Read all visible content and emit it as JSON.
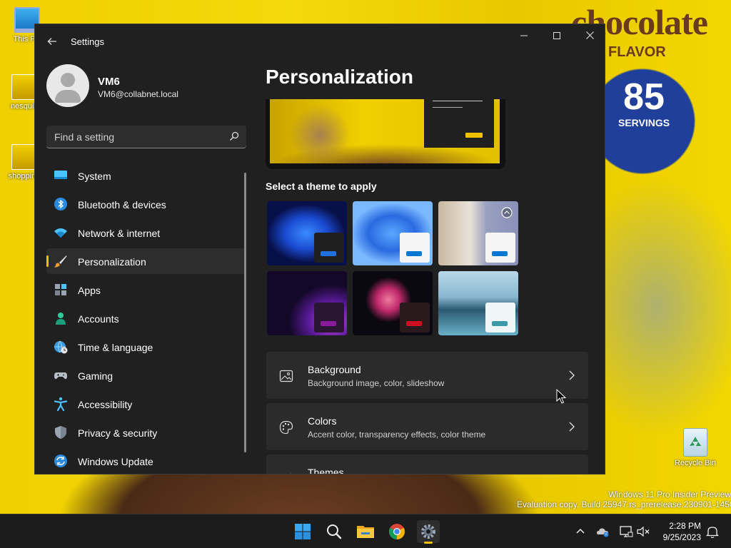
{
  "window": {
    "title": "Settings",
    "back_icon": "back-arrow-icon",
    "minimize": "─",
    "maximize": "☐",
    "close": "✕"
  },
  "user": {
    "name": "VM6",
    "email": "VM6@collabnet.local"
  },
  "search": {
    "placeholder": "Find a setting",
    "value": ""
  },
  "nav": {
    "items": [
      {
        "label": "System",
        "icon": "monitor-icon"
      },
      {
        "label": "Bluetooth & devices",
        "icon": "bluetooth-icon"
      },
      {
        "label": "Network & internet",
        "icon": "wifi-icon"
      },
      {
        "label": "Personalization",
        "icon": "paintbrush-icon",
        "active": true
      },
      {
        "label": "Apps",
        "icon": "apps-icon"
      },
      {
        "label": "Accounts",
        "icon": "person-icon"
      },
      {
        "label": "Time & language",
        "icon": "globe-clock-icon"
      },
      {
        "label": "Gaming",
        "icon": "gamepad-icon"
      },
      {
        "label": "Accessibility",
        "icon": "accessibility-icon"
      },
      {
        "label": "Privacy & security",
        "icon": "shield-icon"
      },
      {
        "label": "Windows Update",
        "icon": "update-icon"
      }
    ]
  },
  "content": {
    "title": "Personalization",
    "theme_section": "Select a theme to apply",
    "themes": [
      {
        "name": "windows-dark",
        "bg": "#0a1a6a",
        "accent": "#2070e0",
        "window": "#1f1f1f"
      },
      {
        "name": "windows-light",
        "bg": "#3a7de0",
        "accent": "#0078d4",
        "window": "#f5f5f5"
      },
      {
        "name": "glow",
        "bg": "#7a8aa0",
        "accent": "#0078d4",
        "window": "#f5f5f5"
      },
      {
        "name": "captured-motion",
        "bg": "#1a0a30",
        "accent": "#8a1a9a",
        "window": "#2b1535"
      },
      {
        "name": "flow",
        "bg": "#150a1a",
        "accent": "#d01020",
        "window": "#2a1a1e"
      },
      {
        "name": "sunrise",
        "bg": "#7ab0c8",
        "accent": "#3a9aaa",
        "window": "#eef6f8"
      }
    ],
    "cards": [
      {
        "title": "Background",
        "subtitle": "Background image, color, slideshow",
        "icon": "image-icon"
      },
      {
        "title": "Colors",
        "subtitle": "Accent color, transparency effects, color theme",
        "icon": "palette-icon"
      },
      {
        "title": "Themes",
        "subtitle": "",
        "icon": "brush-icon"
      }
    ]
  },
  "desktop": {
    "icons": [
      {
        "label": "This PC"
      },
      {
        "label": "nesquik"
      },
      {
        "label": "shopping"
      },
      {
        "label": "Recycle Bin"
      }
    ],
    "wallpaper_text": "chocolate",
    "wallpaper_sub": "FLAVOR",
    "wallpaper_badge": "85",
    "wallpaper_badge_sub": "SERVINGS",
    "watermark_line1": "Windows 11 Pro Insider Preview",
    "watermark_line2": "Evaluation copy. Build 25947.rs_prerelease.230901-1450"
  },
  "taskbar": {
    "time": "2:28 PM",
    "date": "9/25/2023"
  },
  "colors": {
    "accent": "#f0c000",
    "window_bg": "#202020",
    "card_bg": "#2b2b2b"
  }
}
